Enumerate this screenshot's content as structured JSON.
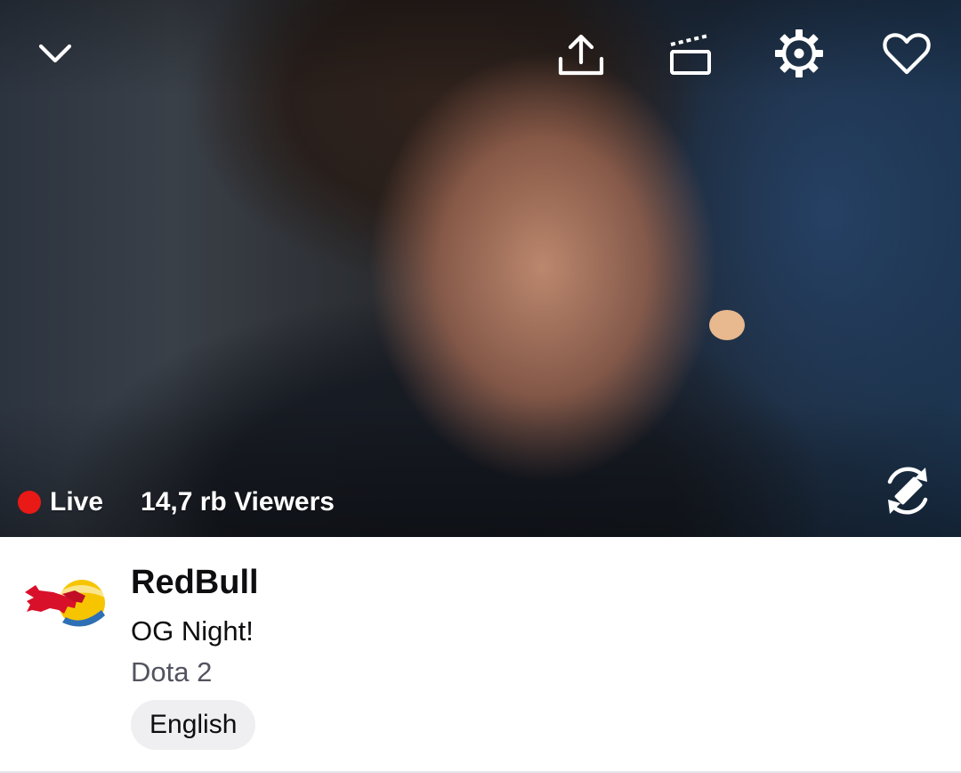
{
  "player": {
    "live_label": "Live",
    "viewer_count": "14,7 rb Viewers",
    "live_color": "#e91916",
    "icons": {
      "collapse": "chevron-down-icon",
      "share": "share-icon",
      "clip": "clip-icon",
      "settings": "gear-icon",
      "follow": "heart-icon",
      "rotate": "rotate-screen-icon"
    }
  },
  "channel": {
    "name": "RedBull",
    "stream_title": "OG Night!",
    "game": "Dota 2",
    "tags": [
      "English"
    ],
    "logo": "redbull-logo"
  }
}
